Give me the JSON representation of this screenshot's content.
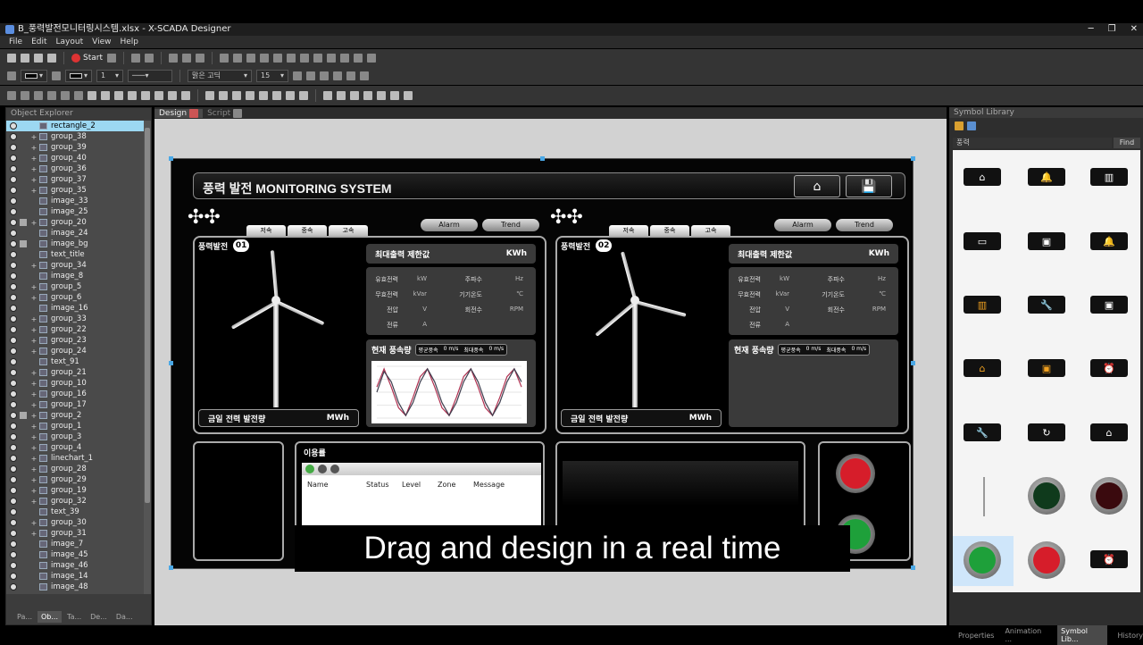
{
  "window": {
    "title": "B_풍력발전모니터링시스템.xlsx - X-SCADA Designer",
    "min": "─",
    "restore": "❐",
    "close": "✕"
  },
  "menu": [
    "File",
    "Edit",
    "Layout",
    "View",
    "Help"
  ],
  "toolbar": {
    "start_label": "Start",
    "font": "맑은 고딕",
    "size": "15",
    "line_width": "1"
  },
  "object_explorer": {
    "title": "Object Explorer",
    "items": [
      {
        "name": "rectangle_2",
        "selected": true
      },
      {
        "name": "group_38"
      },
      {
        "name": "group_39"
      },
      {
        "name": "group_40"
      },
      {
        "name": "group_36"
      },
      {
        "name": "group_37"
      },
      {
        "name": "group_35"
      },
      {
        "name": "image_33"
      },
      {
        "name": "image_25"
      },
      {
        "name": "group_20"
      },
      {
        "name": "image_24"
      },
      {
        "name": "image_bg"
      },
      {
        "name": "text_title"
      },
      {
        "name": "group_34"
      },
      {
        "name": "image_8"
      },
      {
        "name": "group_5"
      },
      {
        "name": "group_6"
      },
      {
        "name": "image_16"
      },
      {
        "name": "group_33"
      },
      {
        "name": "group_22"
      },
      {
        "name": "group_23"
      },
      {
        "name": "group_24"
      },
      {
        "name": "text_91"
      },
      {
        "name": "group_21"
      },
      {
        "name": "group_10"
      },
      {
        "name": "group_16"
      },
      {
        "name": "group_17"
      },
      {
        "name": "group_2"
      },
      {
        "name": "group_1"
      },
      {
        "name": "group_3"
      },
      {
        "name": "group_4"
      },
      {
        "name": "linechart_1"
      },
      {
        "name": "group_28"
      },
      {
        "name": "group_29"
      },
      {
        "name": "group_19"
      },
      {
        "name": "group_32"
      },
      {
        "name": "text_39"
      },
      {
        "name": "group_30"
      },
      {
        "name": "group_31"
      },
      {
        "name": "image_7"
      },
      {
        "name": "image_45"
      },
      {
        "name": "image_46"
      },
      {
        "name": "image_14"
      },
      {
        "name": "image_48"
      }
    ],
    "bottom_tabs": [
      "Pa...",
      "Ob...",
      "Ta...",
      "De...",
      "Da..."
    ]
  },
  "doc_tabs": {
    "design": "Design",
    "script": "Script"
  },
  "hmi": {
    "title": "풍력 발전 MONITORING SYSTEM",
    "speed_tabs": [
      "저속",
      "중속",
      "고속"
    ],
    "alarm": "Alarm",
    "trend": "Trend",
    "panel1_label": "풍력발전",
    "panel1_num": "01",
    "panel2_label": "풍력발전",
    "panel2_num": "02",
    "max_limit": "최대출력 제한값",
    "kwh": "KWh",
    "params": {
      "active": "유효전력",
      "kw": "kW",
      "freq": "주파수",
      "hz": "Hz",
      "reactive": "무효전력",
      "kvar": "kVar",
      "temp": "기기온도",
      "c": "℃",
      "voltage": "전압",
      "v": "V",
      "rpm_label": "회전수",
      "rpm": "RPM",
      "current": "전류",
      "a": "A"
    },
    "wind_label": "현재 풍속량",
    "avg_wind": "평균풍속",
    "max_wind": "최대풍속",
    "wind_val": "0 m/s",
    "today_energy": "금일 전력 발전량",
    "mwh": "MWh",
    "usage_title": "이용률",
    "table_cols": [
      "Name",
      "Status",
      "Level",
      "Zone",
      "Message"
    ]
  },
  "chart_data": {
    "type": "line",
    "series": [
      {
        "values": [
          0.2,
          0.9,
          0.2,
          -0.6,
          -0.9,
          -0.2,
          0.6,
          0.9,
          0.2,
          -0.6,
          -0.9,
          -0.2,
          0.6,
          0.9,
          0.2,
          -0.6,
          -0.9,
          -0.2,
          0.6,
          0.9,
          0.2
        ],
        "color": "#b03050"
      },
      {
        "values": [
          0.0,
          0.8,
          0.4,
          -0.4,
          -0.9,
          -0.4,
          0.4,
          0.9,
          0.4,
          -0.4,
          -0.9,
          -0.4,
          0.4,
          0.9,
          0.4,
          -0.4,
          -0.9,
          -0.4,
          0.4,
          0.9,
          0.4
        ],
        "color": "#404050"
      }
    ],
    "ylim": [
      -1,
      1
    ]
  },
  "symbol_library": {
    "title": "Symbol Library",
    "search": "풍력",
    "find": "Find",
    "tabs": [
      "Properties",
      "Animation ...",
      "Symbol Lib...",
      "History"
    ]
  },
  "caption": "Drag and design in a real time",
  "colors": {
    "accent": "#9cd8f2",
    "btn_red": "#d61d2a",
    "btn_green": "#1ea03a"
  }
}
